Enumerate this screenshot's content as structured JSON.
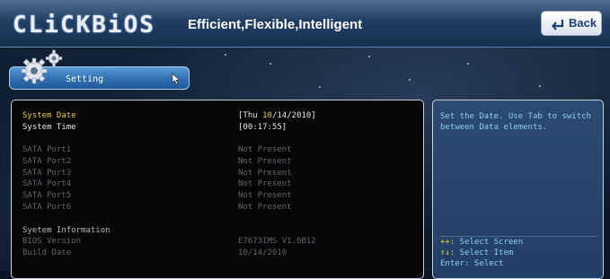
{
  "header": {
    "logo_text": "CLiCKBiOS",
    "tagline": "Efficient,Flexible,Intelligent",
    "back_label": "Back"
  },
  "nav": {
    "active_tab_label": "Setting",
    "active_tab_icon": "gears-icon"
  },
  "main": {
    "system_date": {
      "label": "System Date",
      "value_prefix": "[Thu ",
      "value_highlight": "10",
      "value_suffix": "/14/2010]"
    },
    "system_time": {
      "label": "System Time",
      "value": "[00:17:55]"
    },
    "sata_ports": [
      {
        "label": "SATA Port1",
        "value": "Not Present"
      },
      {
        "label": "SATA Port2",
        "value": "Not Present"
      },
      {
        "label": "SATA Port3",
        "value": "Not Present"
      },
      {
        "label": "SATA Port4",
        "value": "Not Present"
      },
      {
        "label": "SATA Port5",
        "value": "Not Present"
      },
      {
        "label": "SATA Port6",
        "value": "Not Present"
      }
    ],
    "system_info": {
      "heading": "Syetem Information",
      "bios_version_label": "BIOS Version",
      "bios_version_value": "E7673IMS V1.0B12",
      "build_date_label": "Build Date",
      "build_date_value": "10/14/2010"
    }
  },
  "help": {
    "description": "Set the Date. Use Tab to switch between Data elements.",
    "keys": [
      {
        "key": "++:",
        "action": " Select Screen"
      },
      {
        "key": "↑↓:",
        "action": " Select Item"
      },
      {
        "key": "Enter:",
        "action": " Select"
      }
    ]
  },
  "colors": {
    "highlight": "#e8d03c",
    "help_text": "#8fd0ea",
    "tab_blue": "#2f6eb0"
  }
}
